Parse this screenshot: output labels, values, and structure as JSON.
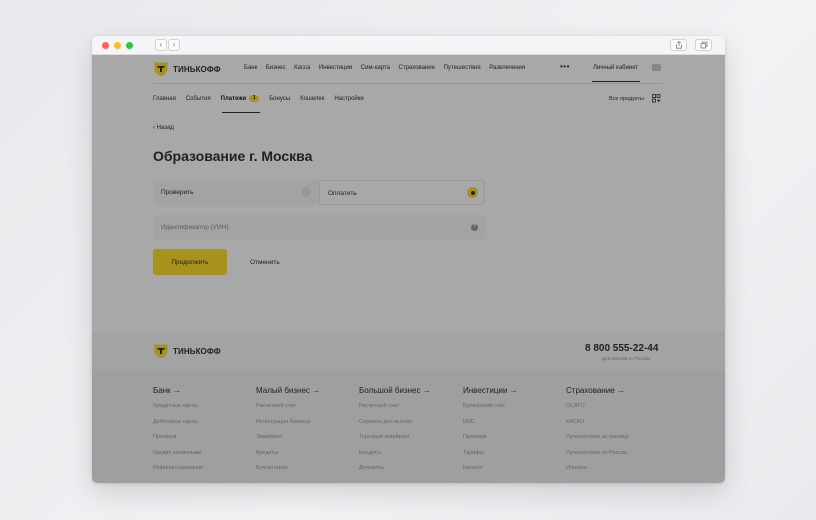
{
  "browser": {
    "back_glyph": "‹",
    "forward_glyph": "›"
  },
  "header": {
    "brand": "ТИНЬКОФФ",
    "nav": [
      "Банк",
      "Бизнес",
      "Касса",
      "Инвестиции",
      "Сим-карта",
      "Страхование",
      "Путешествия",
      "Развлечения"
    ],
    "more": "•••",
    "cabinet": "Личный кабинет"
  },
  "subnav": {
    "items": [
      "Главная",
      "События",
      "Платежи",
      "Бонусы",
      "Кошелек",
      "Настройки"
    ],
    "active_index": 2,
    "badge": "1",
    "all_products": "Все продукты"
  },
  "main": {
    "back": "‹ Назад",
    "title": "Образование г. Москва",
    "option_check": "Проверить",
    "option_pay": "Оплатить",
    "selected": "Оплатить",
    "uin_placeholder": "Идентификатор (УИН)",
    "uin_value": "",
    "continue": "Продолжить",
    "cancel": "Отменить"
  },
  "footer": {
    "brand": "ТИНЬКОФФ",
    "phone": "8 800 555-22-44",
    "phone_note": "Для звонков по России",
    "columns": [
      {
        "title": "Банк →",
        "links": [
          "Кредитные карты",
          "Дебетовые карты",
          "Премиум",
          "Кредит наличными",
          "Рефинансирование"
        ]
      },
      {
        "title": "Малый бизнес →",
        "links": [
          "Расчетный счет",
          "Регистрация бизнеса",
          "Эквайринг",
          "Кредиты",
          "Бухгалтерия"
        ]
      },
      {
        "title": "Большой бизнес →",
        "links": [
          "Расчетный счет",
          "Сервисы для выплат",
          "Торговый эквайринг",
          "Кредиты",
          "Депозиты"
        ]
      },
      {
        "title": "Инвестиции →",
        "links": [
          "Брокерский счет",
          "ИИС",
          "Премиум",
          "Тарифы",
          "Каталог"
        ]
      },
      {
        "title": "Страхование →",
        "links": [
          "ОСАГО",
          "КАСКО",
          "Путешествия за границу",
          "Путешествия по России",
          "Ипотека"
        ]
      }
    ]
  },
  "colors": {
    "accent": "#ffdd2d",
    "text": "#333333",
    "overlay": "rgba(0,0,0,0.34)"
  }
}
